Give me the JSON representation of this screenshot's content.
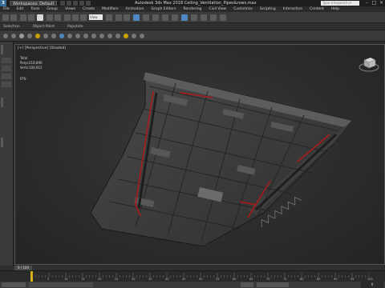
{
  "titlebar": {
    "logo": "3",
    "workspace_label": "Workspaces: Default",
    "title": "Autodesk 3ds Max 2018    Ceiling_Ventilation_Pipes&rows.max",
    "search_placeholder": "Type a keyword or phrase",
    "window_buttons": [
      "–",
      "□",
      "×"
    ]
  },
  "menubar": {
    "items": [
      "File",
      "Edit",
      "Tools",
      "Group",
      "Views",
      "Create",
      "Modifiers",
      "Animation",
      "Graph Editors",
      "Rendering",
      "Civil View",
      "Customize",
      "Scripting",
      "Interactive",
      "Content",
      "Help"
    ]
  },
  "toolbar": {
    "view_select": "View"
  },
  "ribbon": {
    "tabs": [
      "Selection",
      "Object Paint",
      "Populate"
    ]
  },
  "viewport": {
    "label": "[+] [Perspective] [Shaded]",
    "stats_title": "Total",
    "stats": [
      {
        "key": "Polys:",
        "value": "218,890"
      },
      {
        "key": "Verts:",
        "value": "100,915"
      }
    ],
    "fps_label": "FPS:"
  },
  "timeline": {
    "position_label": "0 / 100",
    "ticks": [
      "0",
      "5",
      "10",
      "15",
      "20",
      "25",
      "30",
      "35",
      "40",
      "45",
      "50",
      "55",
      "60",
      "65",
      "70",
      "75",
      "80",
      "85",
      "90",
      "95",
      "100"
    ]
  },
  "statusbar": {
    "frame": "0"
  },
  "colors": {
    "accent": "#4f86c1",
    "time_marker": "#d9b200",
    "pipe_red": "#b01818"
  }
}
